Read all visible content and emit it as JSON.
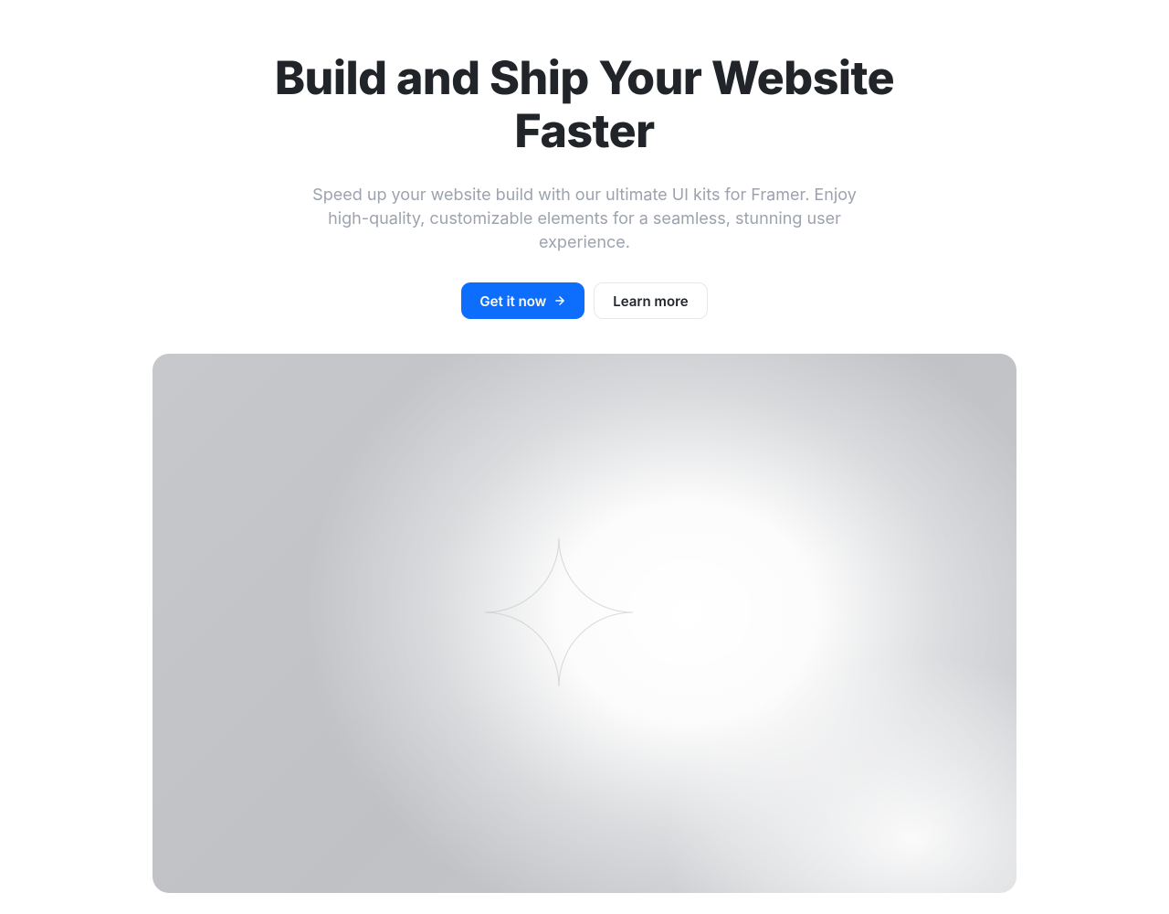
{
  "hero": {
    "headline": "Build and Ship Your Website Faster",
    "subheadline": "Speed up your website build with our ultimate UI kits for Framer. Enjoy high-quality, customizable elements for a seamless, stunning user experience.",
    "cta_primary": "Get it now",
    "cta_secondary": "Learn more"
  }
}
